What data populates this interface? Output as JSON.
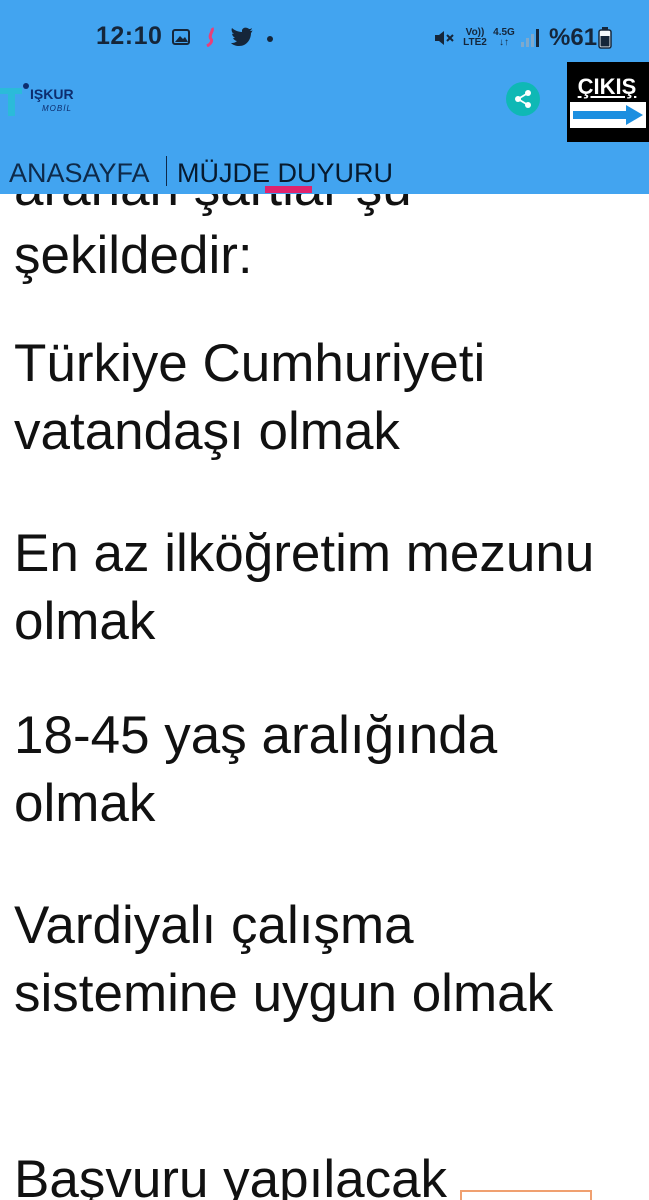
{
  "status_bar": {
    "time": "12:10",
    "volte_label": "Vo))\nLTE2",
    "network_label": "4.5G\n↓↑",
    "battery": "%61",
    "icons": [
      "gallery-icon",
      "app-icon",
      "twitter-icon",
      "notification-dot",
      "mute-icon",
      "signal-icon",
      "battery-icon"
    ]
  },
  "header": {
    "logo_name": "IŞKUR",
    "logo_sub": "MOBİL",
    "share_icon": "share-icon",
    "exit_label": "ÇIKIŞ",
    "colors": {
      "bar": "#42a4f0",
      "share": "#0fb8b5",
      "indicator": "#e0246d",
      "exit_arrow": "#1c8fe0"
    }
  },
  "nav": {
    "home": "ANASAYFA",
    "news": "MÜJDE DUYURU"
  },
  "article": {
    "clipped_line": "aranan şartlar şu",
    "lead": "şekildedir:",
    "requirements": [
      "Türkiye Cumhuriyeti vatandaşı olmak",
      "En az ilköğretim mezunu olmak",
      "18-45 yaş aralığında olmak",
      "Vardiyalı çalışma sistemine uygun olmak"
    ],
    "next_partial": "Başvuru yapılacak"
  }
}
